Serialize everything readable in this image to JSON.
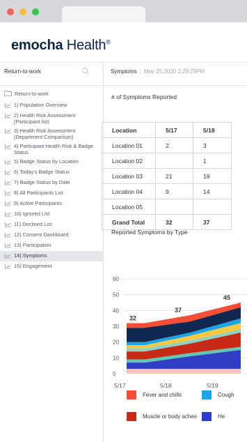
{
  "brand": {
    "name_bold": "emocha",
    "name_rest": " Health",
    "mark": "®"
  },
  "sidebar": {
    "title": "Return-to-work",
    "root": "Return-to-work",
    "items": [
      {
        "label": "1) Population Overview"
      },
      {
        "label": "2) Health Risk Assessment (Participant list)"
      },
      {
        "label": "3) Health Risk Assessment (Department Comparison)"
      },
      {
        "label": "4) Participant Health Risk & Badge Status"
      },
      {
        "label": "5) Badge Status by Location"
      },
      {
        "label": "6) Today's Badge Status"
      },
      {
        "label": "7) Badge Status by Date"
      },
      {
        "label": "8) All Participants List"
      },
      {
        "label": "9) Active Participants"
      },
      {
        "label": "10) Ignored List"
      },
      {
        "label": "11) Declined List"
      },
      {
        "label": "12) Consent Dashboard"
      },
      {
        "label": "13) Participation"
      },
      {
        "label": "14) Symptoms",
        "active": true
      },
      {
        "label": "15) Engagement"
      }
    ]
  },
  "header": {
    "section": "Symptoms",
    "separator": "|",
    "timestamp": "May 25,2020 2:29:29PM"
  },
  "table": {
    "title": "# of Symptoms Reported",
    "columns": [
      "Location",
      "5/17",
      "5/18"
    ],
    "rows": [
      [
        "Location 01",
        "2",
        "3"
      ],
      [
        "Location 02",
        "",
        "1"
      ],
      [
        "Location 03",
        "21",
        "19"
      ],
      [
        "Location 04",
        "9",
        "14"
      ],
      [
        "Location 05",
        "",
        ""
      ]
    ],
    "total": [
      "Grand Total",
      "32",
      "37"
    ]
  },
  "chart_title": "Reported Symptoms by Type",
  "chart_data": {
    "type": "area",
    "stacked": true,
    "x": [
      "5/17",
      "5/18",
      "5/19"
    ],
    "ylim": [
      0,
      60
    ],
    "yticks": [
      0,
      10,
      20,
      30,
      40,
      50,
      60
    ],
    "grid": true,
    "totals_labels": [
      "32",
      "37",
      "45"
    ],
    "series": [
      {
        "color": "#f8c3bb",
        "values": [
          3,
          3,
          3
        ]
      },
      {
        "name": "Headache",
        "color": "#2f3fc4",
        "values": [
          4,
          8,
          12
        ]
      },
      {
        "color": "#5fc8b5",
        "values": [
          2,
          2,
          2
        ]
      },
      {
        "name": "Muscle or body aches",
        "color": "#c72a14",
        "values": [
          5,
          6,
          9
        ]
      },
      {
        "color": "#8ed1c7",
        "values": [
          2,
          2,
          2
        ]
      },
      {
        "color": "#f5c842",
        "values": [
          2,
          3,
          4
        ]
      },
      {
        "name": "Cough",
        "color": "#1ba4e6",
        "values": [
          2,
          2,
          3
        ]
      },
      {
        "color": "#10274f",
        "values": [
          9,
          7,
          7
        ]
      },
      {
        "name": "Fever and chills",
        "color": "#f44e36",
        "values": [
          3,
          4,
          3
        ]
      }
    ]
  },
  "legend": [
    {
      "label": "Fever and chills",
      "color": "#f44e36"
    },
    {
      "label": "Cough",
      "color": "#1ba4e6"
    },
    {
      "label": "Muscle or body aches",
      "color": "#c72a14"
    },
    {
      "label": "He",
      "color": "#2f3fc4"
    }
  ],
  "colors": {
    "frame": "#1f3a93",
    "brand_text": "#0e2544",
    "active_nav": "#e6e7ea"
  }
}
